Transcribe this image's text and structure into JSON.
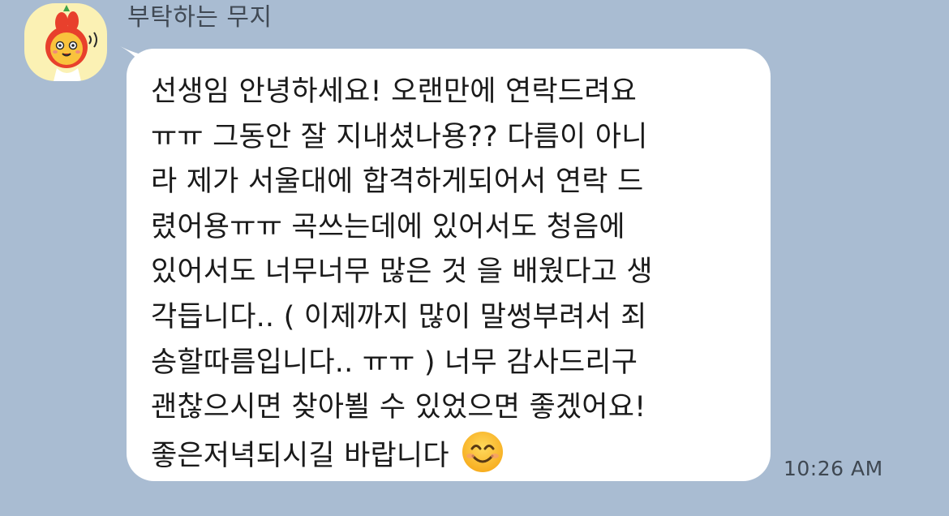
{
  "chat": {
    "sender_name": "부탁하는 무지",
    "avatar_icon": "muzi-avatar-icon",
    "message": {
      "lines": [
        "선생임 안녕하세요! 오랜만에 연락드려요",
        "ㅠㅠ 그동안 잘 지내셨나용?? 다름이 아니",
        "라 제가 서울대에 합격하게되어서 연락 드",
        "렸어용ㅠㅠ 곡쓰는데에 있어서도 청음에",
        "있어서도 너무너무 많은 것 을 배웠다고 생",
        "각듭니다.. ( 이제까지 많이 말썽부려서 죄",
        "송할따름입니다.. ㅠㅠ ) 너무 감사드리구",
        "괜찮으시면 찾아뵐 수 있었으면 좋겠어요!",
        "좋은저녁되시길 바랍니다"
      ],
      "trailing_emoji": "smiling-face-emoji",
      "time": "10:26 AM"
    }
  },
  "colors": {
    "background": "#a9bcd2",
    "bubble": "#ffffff",
    "text": "#1a1a1a",
    "meta_text": "#3f4852",
    "avatar_bg": "#fbf1b4"
  }
}
